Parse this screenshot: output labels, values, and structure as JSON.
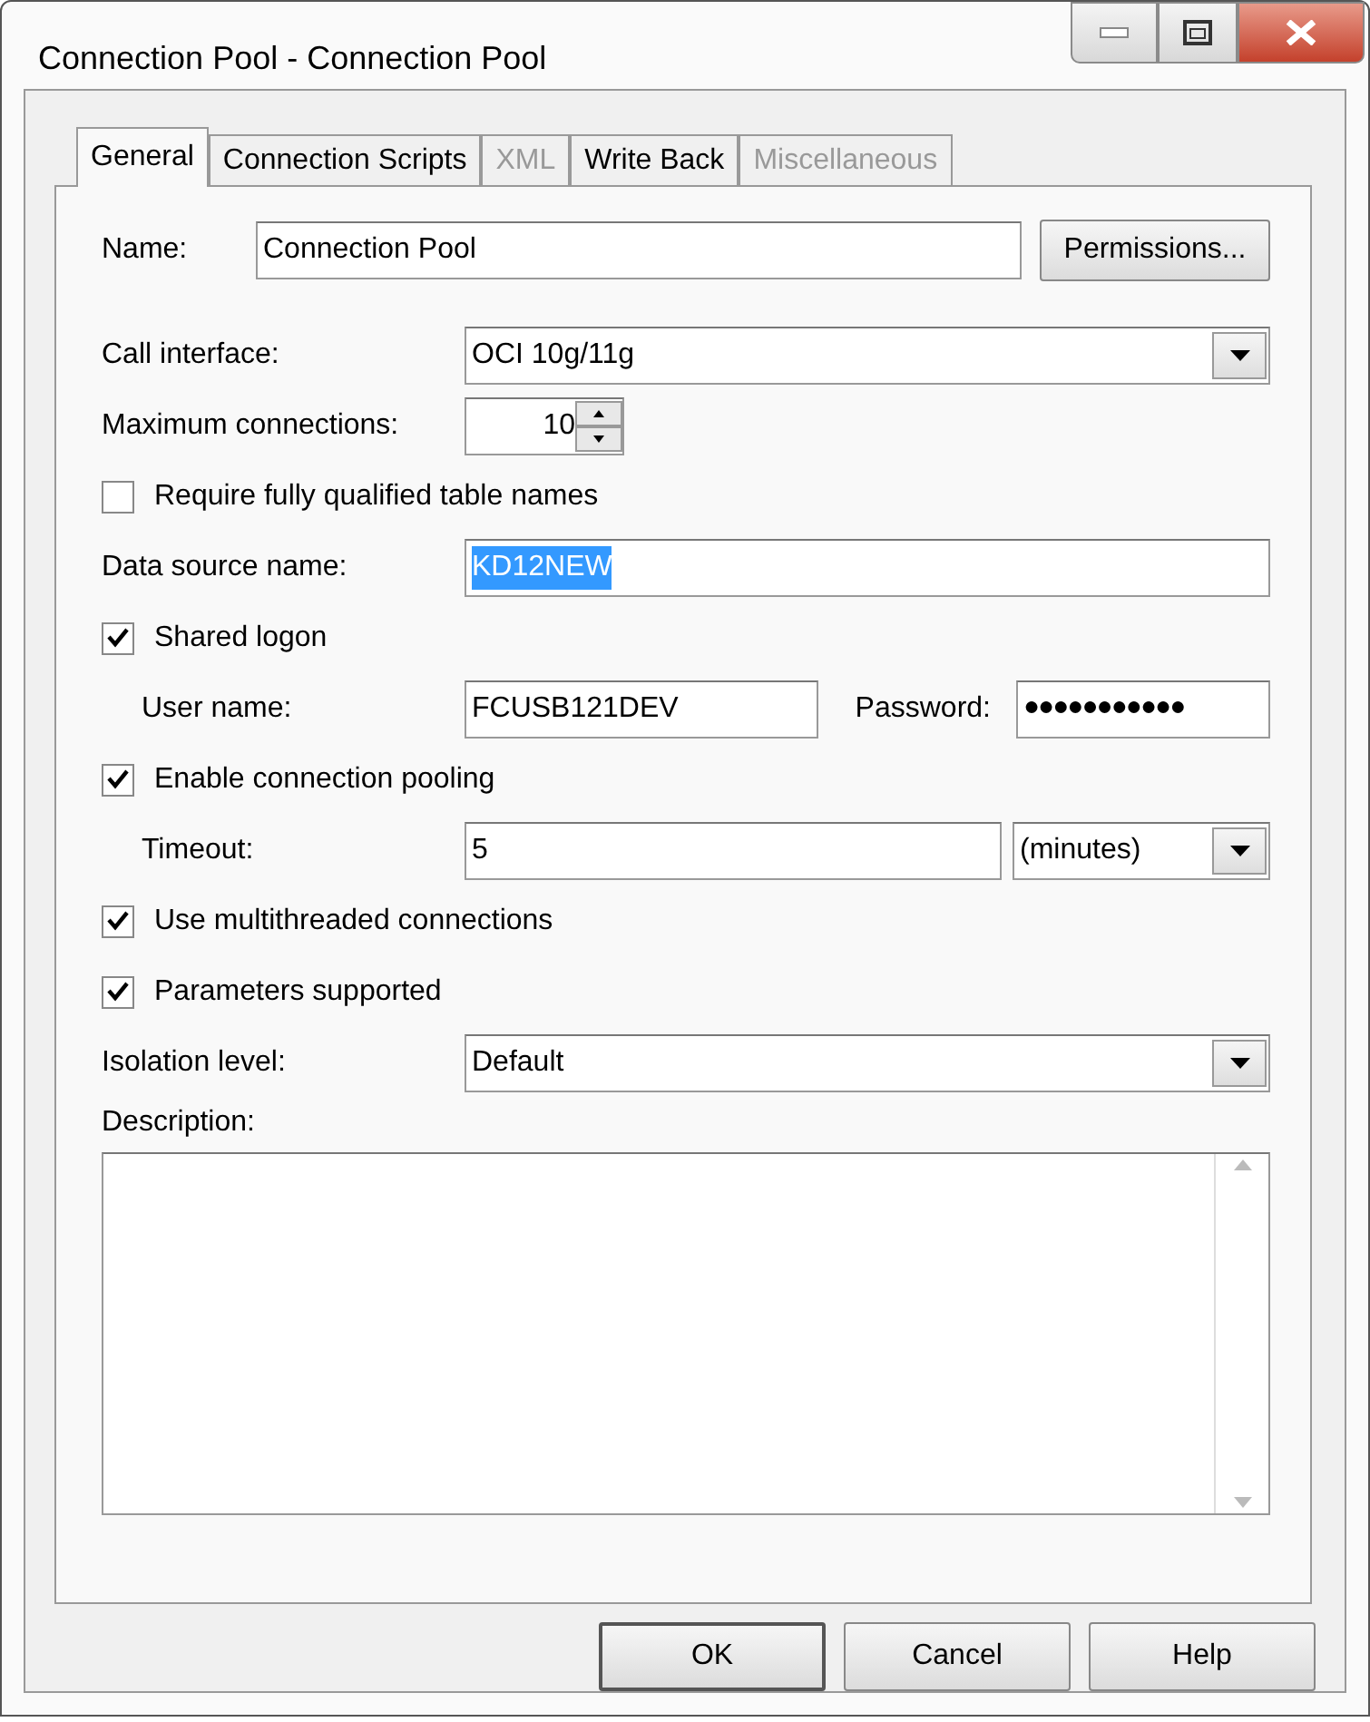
{
  "window": {
    "title": "Connection Pool - Connection Pool"
  },
  "tabs": [
    {
      "label": "General",
      "selected": true,
      "disabled": false
    },
    {
      "label": "Connection Scripts",
      "selected": false,
      "disabled": false
    },
    {
      "label": "XML",
      "selected": false,
      "disabled": true
    },
    {
      "label": "Write Back",
      "selected": false,
      "disabled": false
    },
    {
      "label": "Miscellaneous",
      "selected": false,
      "disabled": true
    }
  ],
  "form": [
    {
      "kind": "name",
      "label": "Name:",
      "value": "Connection Pool",
      "button": "Permissions..."
    },
    {
      "kind": "combo",
      "label": "Call interface:",
      "value": "OCI 10g/11g"
    },
    {
      "kind": "spin",
      "label": "Maximum connections:",
      "value": "10"
    },
    {
      "kind": "checkbox",
      "label": "Require fully qualified table names",
      "checked": false
    },
    {
      "kind": "text",
      "label": "Data source name:",
      "value": "KD12NEW",
      "selected": true
    },
    {
      "kind": "checkbox",
      "label": "Shared logon",
      "checked": true
    },
    {
      "kind": "logon",
      "label": "User name:",
      "value": "FCUSB121DEV",
      "password_label": "Password:",
      "password": "●●●●●●●●●●●"
    },
    {
      "kind": "checkbox",
      "label": "Enable connection pooling",
      "checked": true
    },
    {
      "kind": "timeout",
      "label": "Timeout:",
      "value": "5",
      "unit": "(minutes)"
    },
    {
      "kind": "checkbox",
      "label": "Use multithreaded connections",
      "checked": true
    },
    {
      "kind": "checkbox",
      "label": "Parameters supported",
      "checked": true
    },
    {
      "kind": "combo",
      "label": "Isolation level:",
      "value": "Default"
    },
    {
      "kind": "textarea",
      "label": "Description:"
    }
  ],
  "buttons": [
    {
      "label": "OK",
      "default": true
    },
    {
      "label": "Cancel",
      "default": false
    },
    {
      "label": "Help",
      "default": false
    }
  ]
}
